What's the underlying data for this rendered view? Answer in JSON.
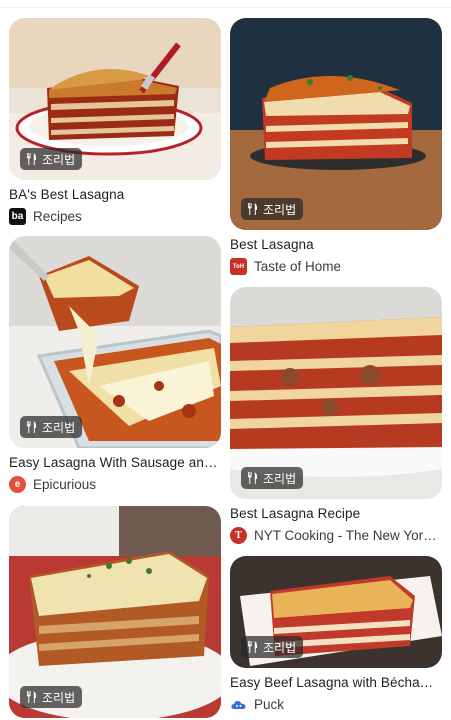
{
  "badge_label": "조리법",
  "cards": [
    {
      "title": "BA's Best Lasagna",
      "source": "Recipes",
      "logo_text": "ba",
      "logo_color": "#111111"
    },
    {
      "title": "Easy Lasagna With Sausage and…",
      "source": "Epicurious",
      "logo_text": "e",
      "logo_color": "#e2503c"
    },
    {
      "title": "",
      "source": "",
      "logo_text": "",
      "logo_color": ""
    },
    {
      "title": "Best Lasagna",
      "source": "Taste of Home",
      "logo_text": "ToH",
      "logo_color": "#c8302a"
    },
    {
      "title": "Best Lasagna Recipe",
      "source": "NYT Cooking - The New York…",
      "logo_text": "T",
      "logo_color": "#c8302a"
    },
    {
      "title": "Easy Beef Lasagna with Béchamel…",
      "source": "Puck",
      "logo_text": "",
      "logo_color": "#3a6fd8"
    }
  ],
  "colors": {
    "badge_bg": "#282828",
    "text": "#1f1f1f",
    "secondary_text": "#3c3c3c"
  },
  "icons": {
    "badge": "fork-knife-icon"
  }
}
